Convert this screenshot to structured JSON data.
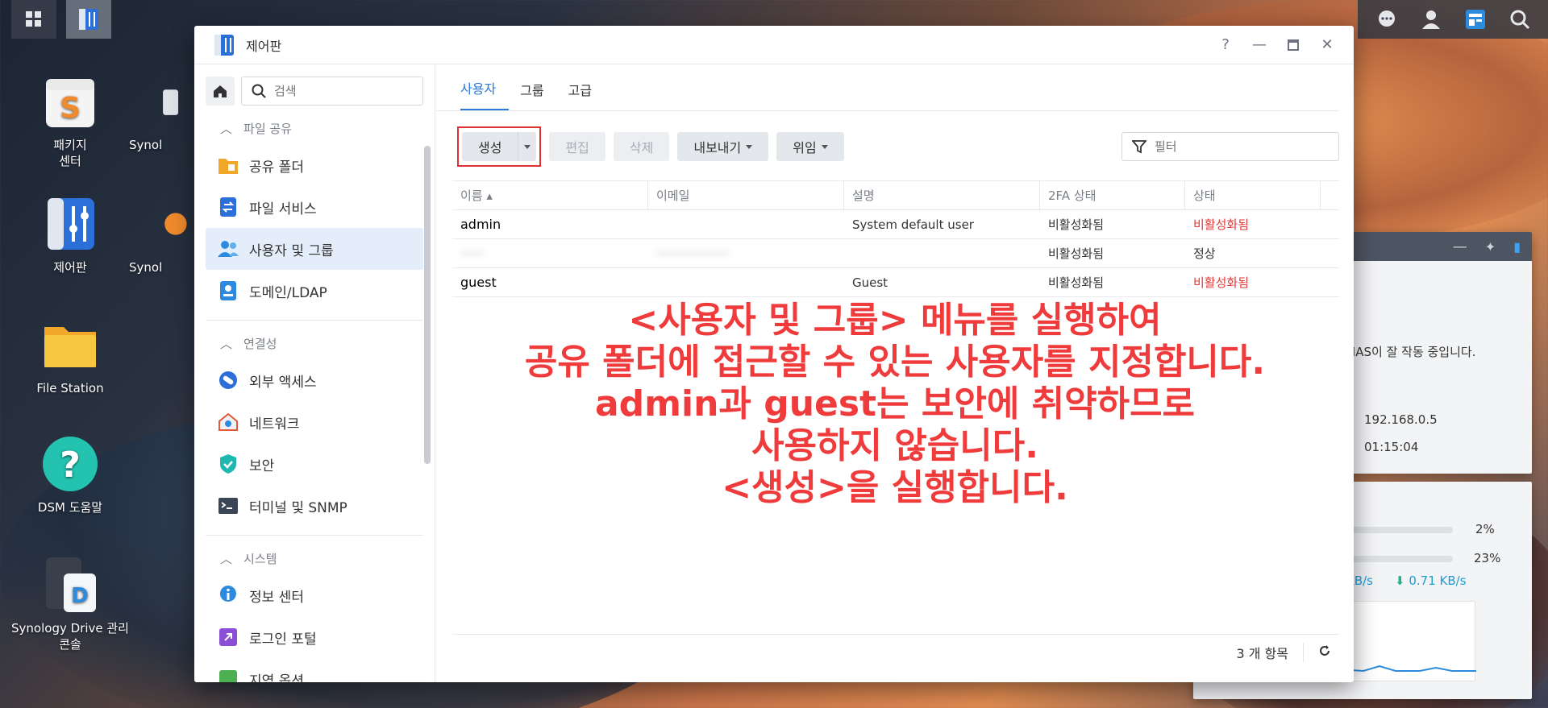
{
  "desktop": {
    "icons": [
      {
        "label": "패키지\n센터"
      },
      {
        "label": "Synol"
      },
      {
        "label": "제어판"
      },
      {
        "label": "Synol"
      },
      {
        "label": "File Station"
      },
      {
        "label": "DSM 도움말"
      },
      {
        "label": "Synology Drive 관리\n콘솔"
      }
    ]
  },
  "widgets": {
    "status_text": "NAS이 잘 작동 중입니다.",
    "ip": "192.168.0.5",
    "uptime": "01:15:04",
    "cpu": "2%",
    "ram": "23%",
    "upload": "KB/s",
    "download": "0.71 KB/s"
  },
  "window": {
    "title": "제어판",
    "help": "?",
    "search_placeholder": "검색",
    "sidebar": {
      "sections": [
        {
          "label": "파일 공유",
          "items": [
            "공유 폴더",
            "파일 서비스",
            "사용자 및 그룹",
            "도메인/LDAP"
          ]
        },
        {
          "label": "연결성",
          "items": [
            "외부 액세스",
            "네트워크",
            "보안",
            "터미널 및 SNMP"
          ]
        },
        {
          "label": "시스템",
          "items": [
            "정보 센터",
            "로그인 포털",
            "지역 옵션"
          ]
        }
      ]
    },
    "tabs": [
      "사용자",
      "그룹",
      "고급"
    ],
    "toolbar": {
      "create": "생성",
      "edit": "편집",
      "delete": "삭제",
      "export": "내보내기",
      "delegate": "위임",
      "filter_placeholder": "필터"
    },
    "table": {
      "columns": [
        "이름 ▴",
        "이메일",
        "설명",
        "2FA 상태",
        "상태"
      ],
      "rows": [
        [
          "admin",
          "",
          "System default user",
          "비활성화됨",
          "비활성화됨"
        ],
        [
          "······",
          "··················",
          "",
          "비활성화됨",
          "정상"
        ],
        [
          "guest",
          "",
          "Guest",
          "비활성화됨",
          "비활성화됨"
        ]
      ]
    },
    "footer": {
      "count": "3 개 항목"
    }
  },
  "annotation": {
    "lines": [
      "<사용자 및 그룹> 메뉴를 실행하여",
      "공유 폴더에 접근할 수 있는 사용자를 지정합니다.",
      "admin과 guest는 보안에 취약하므로",
      "사용하지 않습니다.",
      "<생성>을 실행합니다."
    ]
  }
}
